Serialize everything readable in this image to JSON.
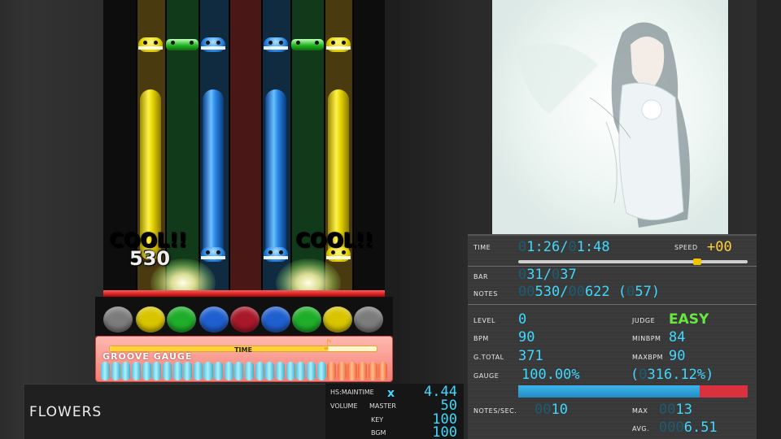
{
  "judgements": [
    {
      "text": "COOL!!",
      "combo": "530"
    },
    {
      "text": "COOL!!"
    }
  ],
  "gauge": {
    "label": "GROOVE GAUGE",
    "time_label": "TIME",
    "time_progress": 0.82,
    "cells_total": 28,
    "cells_normal": 22
  },
  "song": {
    "title": "FLOWERS"
  },
  "options": {
    "hs_label": "HS:MAINTIME",
    "hs_x": "x",
    "hs_value": "4.44",
    "volume_label": "VOLUME",
    "master_label": "MASTER",
    "master_value": "50",
    "key_label": "KEY",
    "key_value": "100",
    "bgm_label": "BGM",
    "bgm_value": "100"
  },
  "stats": {
    "time_label": "TIME",
    "time_current": "1:26",
    "time_slash": "/",
    "time_total": "1:48",
    "speed_label": "SPEED",
    "speed_value": "+00",
    "speed_position": 0.78,
    "bar_label": "BAR",
    "bar_current": "31",
    "bar_total": "37",
    "notes_label": "NOTES",
    "notes_current": "530",
    "notes_total": "622",
    "notes_remaining": "57",
    "level_label": "LEVEL",
    "level_value": "0",
    "judge_label": "JUDGE",
    "judge_value": "EASY",
    "bpm_label": "BPM",
    "bpm_value": "90",
    "minbpm_label": "MINBPM",
    "minbpm_value": "84",
    "gtotal_label": "G.TOTAL",
    "gtotal_value": "371",
    "maxbpm_label": "MAXBPM",
    "maxbpm_value": "90",
    "gauge_label": "GAUGE",
    "gauge_value": "100.00%",
    "gauge_extra": "316.12%",
    "gauge_fill": 0.79,
    "nps_label": "NOTES/SEC.",
    "nps_value": "10",
    "max_label": "MAX",
    "max_value": "13",
    "avg_label": "AVG.",
    "avg_value": "6.51"
  },
  "colors": {
    "digit": "#3fd8ff",
    "judge_easy": "#66e83f",
    "judge_line": "#d21515"
  }
}
